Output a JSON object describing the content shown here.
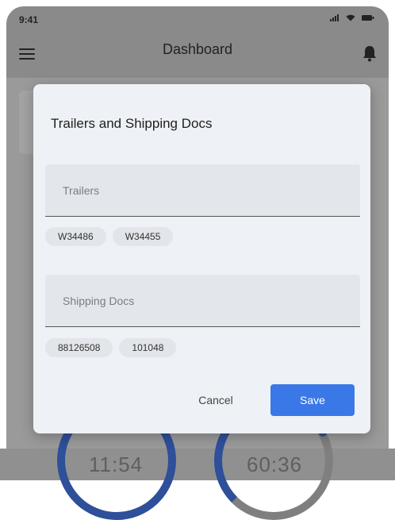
{
  "status_bar": {
    "time": "9:41"
  },
  "app_bar": {
    "title": "Dashboard"
  },
  "background": {
    "timer_left": "11:54",
    "timer_right": "60:36",
    "accent_color": "#1e7a4c",
    "ring_color": "#2e4f99"
  },
  "dialog": {
    "title": "Trailers and Shipping Docs",
    "trailers": {
      "label": "Trailers",
      "chips": [
        "W34486",
        "W34455"
      ]
    },
    "shipping_docs": {
      "label": "Shipping Docs",
      "chips": [
        "88126508",
        "101048"
      ]
    },
    "cancel_label": "Cancel",
    "save_label": "Save",
    "save_color": "#3b78e7"
  }
}
